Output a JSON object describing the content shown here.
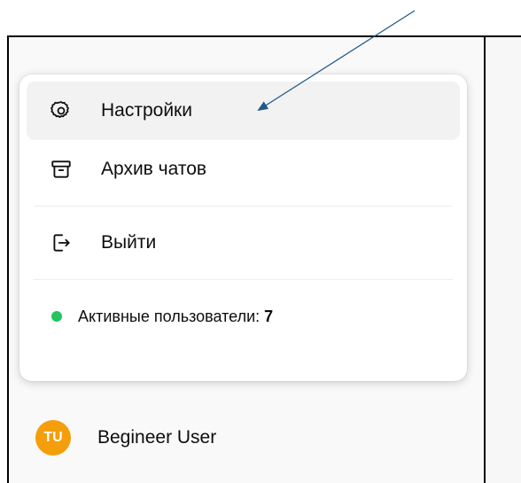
{
  "menu": {
    "items": [
      {
        "label": "Настройки",
        "icon": "gear-icon",
        "active": true
      },
      {
        "label": "Архив чатов",
        "icon": "archive-icon",
        "active": false
      },
      {
        "label": "Выйти",
        "icon": "logout-icon",
        "active": false
      }
    ],
    "status": {
      "label": "Активные пользователи:",
      "count": "7",
      "dot_color": "#22c55e"
    }
  },
  "user": {
    "initials": "TU",
    "name": "Begineer User",
    "avatar_color": "#f59e0b"
  },
  "annotation": {
    "arrow_color": "#1f5a8a"
  }
}
